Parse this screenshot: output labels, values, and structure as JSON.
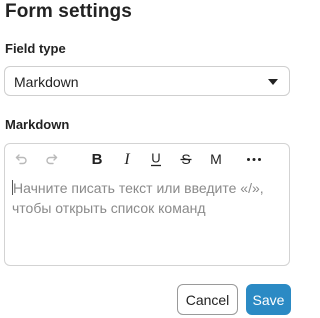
{
  "form": {
    "title": "Form settings"
  },
  "field_type": {
    "label": "Field type",
    "selected": "Markdown",
    "caret_icon": "caret-down-icon"
  },
  "markdown": {
    "label": "Markdown",
    "placeholder": "Начните писать текст или введите «/», чтобы открыть список команд",
    "toolbar": {
      "undo": "undo-icon",
      "redo": "redo-icon",
      "bold": "B",
      "italic": "I",
      "underline": "U",
      "strikethrough": "S",
      "monospace": "M",
      "more": "•••"
    }
  },
  "actions": {
    "cancel_label": "Cancel",
    "save_label": "Save"
  },
  "colors": {
    "primary": "#2b8ac4",
    "border": "#cfcfcf",
    "placeholder": "#8a8a8a"
  }
}
